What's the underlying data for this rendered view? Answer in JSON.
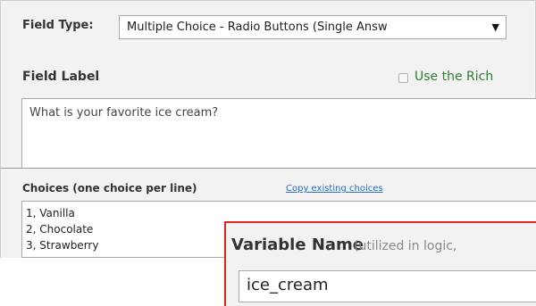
{
  "field_type": {
    "label": "Field Type:",
    "selected": "Multiple Choice - Radio Buttons (Single Answ",
    "arrow": "▼"
  },
  "field_label": {
    "label": "Field Label",
    "rich_text_label": "Use the Rich",
    "rich_text_checked": false,
    "value": "What is your favorite ice cream?"
  },
  "choices": {
    "label": "Choices (one choice per line)",
    "copy_link": "Copy existing choices",
    "lines": [
      "1, Vanilla",
      "2, Chocolate",
      "3, Strawberry"
    ]
  },
  "variable_name": {
    "label": "Variable Name",
    "hint": "(utilized in logic,",
    "value": "ice_cream"
  },
  "colors": {
    "panel_bg": "#f2f2f2",
    "rich_text_green": "#2e7d32",
    "link_blue": "#2a6fb7",
    "callout_red": "#e0241b"
  }
}
